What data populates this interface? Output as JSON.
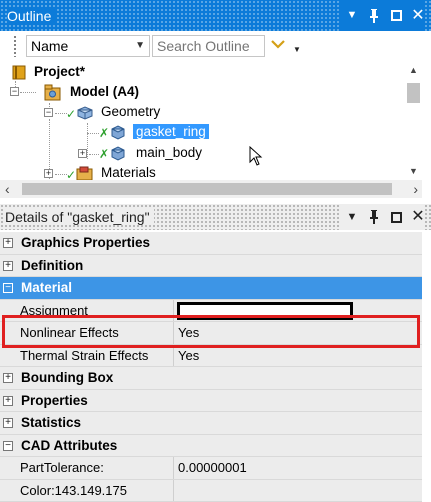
{
  "outline_panel": {
    "title": "Outline",
    "controls": {
      "dropdown": "▼",
      "pin": "Ⅱ",
      "close": "✕"
    }
  },
  "toolbar": {
    "filter_value": "Name",
    "search_placeholder": "Search Outline"
  },
  "tree": {
    "project": "Project*",
    "model": "Model (A4)",
    "geometry": "Geometry",
    "gasket": "gasket_ring",
    "main_body": "main_body",
    "materials": "Materials"
  },
  "details_panel": {
    "title": "Details of \"gasket_ring\"",
    "controls": {
      "dropdown": "▼",
      "pin": "Ⅱ",
      "close": "✕"
    }
  },
  "grid": {
    "sections": {
      "graphics": "Graphics Properties",
      "definition": "Definition",
      "material": "Material",
      "bounding_box": "Bounding Box",
      "properties": "Properties",
      "statistics": "Statistics",
      "cad": "CAD Attributes"
    },
    "rows": {
      "assignment_name": "Assignment",
      "nonlinear_name": "Nonlinear Effects",
      "nonlinear_value": "Yes",
      "thermal_name": "Thermal Strain Effects",
      "thermal_value": "Yes",
      "tolerance_name": "PartTolerance:",
      "tolerance_value": "0.00000001",
      "color_name": "Color:143.149.175"
    }
  },
  "colors": {
    "titlebar": "#0c7bd9",
    "selection": "#3399ff",
    "active_section": "#3d95e6",
    "highlight": "#e02020"
  }
}
